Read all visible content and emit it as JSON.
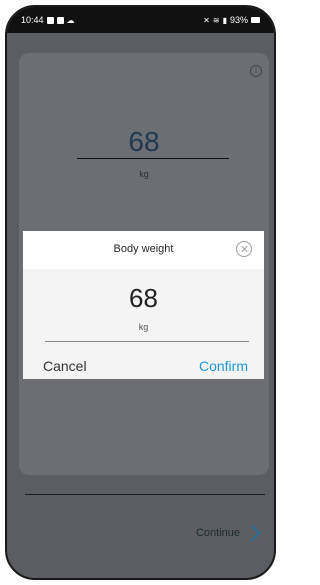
{
  "status_bar": {
    "time": "10:44",
    "battery": "93%",
    "icons": [
      "image-icon",
      "notification-icon",
      "cloud-icon",
      "mute-icon",
      "wifi-icon",
      "signal-icon",
      "battery-icon"
    ]
  },
  "background_card": {
    "value": "68",
    "unit": "kg",
    "info_icon": "info-icon"
  },
  "footer": {
    "continue_label": "Continue",
    "continue_icon": "chevron-right-icon"
  },
  "dialog": {
    "title": "Body weight",
    "value": "68",
    "unit": "kg",
    "cancel_label": "Cancel",
    "confirm_label": "Confirm",
    "close_icon": "close-icon"
  },
  "colors": {
    "accent": "#1f97d8",
    "overlay": "#5b5d62",
    "status_bar": "#111111"
  }
}
